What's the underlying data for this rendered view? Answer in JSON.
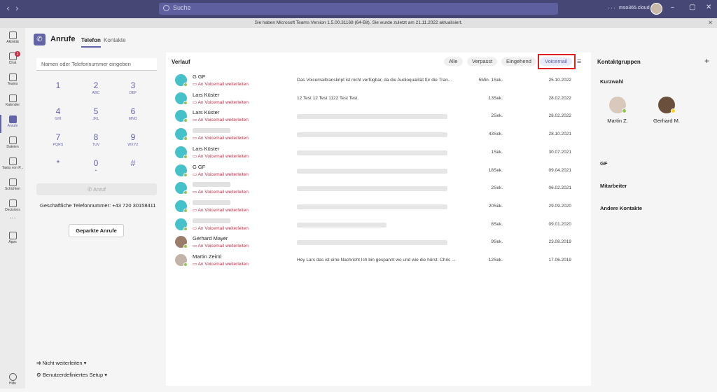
{
  "titlebar": {
    "search_placeholder": "Suche",
    "more": "···",
    "tenant": "mso365.cloud",
    "back": "‹",
    "forward": "›",
    "minimize": "–",
    "maximize": "▢",
    "close": "✕"
  },
  "banner": {
    "text": "Sie haben Microsoft Teams Version 1.5.00.31168 (64-Bit). Sie wurde zuletzt am 21.11.2022 aktualisiert.",
    "close": "✕"
  },
  "rail": [
    {
      "label": "Aktivität",
      "icon": "bell-icon"
    },
    {
      "label": "Chat",
      "icon": "chat-icon",
      "badge": "1"
    },
    {
      "label": "Teams",
      "icon": "teams-icon"
    },
    {
      "label": "Kalender",
      "icon": "calendar-icon"
    },
    {
      "label": "Anrufe",
      "icon": "phone-icon",
      "active": true
    },
    {
      "label": "Dateien",
      "icon": "file-icon"
    },
    {
      "label": "Tasks von P...",
      "icon": "tasks-icon"
    },
    {
      "label": "Schichten",
      "icon": "shifts-icon"
    },
    {
      "label": "Decisions",
      "icon": "decisions-icon"
    },
    {
      "label": "",
      "icon": "more-apps-icon"
    },
    {
      "label": "Apps",
      "icon": "apps-icon"
    },
    {
      "label": "Hilfe",
      "icon": "help-icon"
    }
  ],
  "header": {
    "title": "Anrufe",
    "tabs": [
      "Telefon",
      "Kontakte"
    ]
  },
  "dialpad": {
    "placeholder": "Namen oder Telefonnummer eingeben",
    "keys": [
      {
        "d": "1",
        "l": ""
      },
      {
        "d": "2",
        "l": "ABC"
      },
      {
        "d": "3",
        "l": "DEF"
      },
      {
        "d": "4",
        "l": "GHI"
      },
      {
        "d": "5",
        "l": "JKL"
      },
      {
        "d": "6",
        "l": "MNO"
      },
      {
        "d": "7",
        "l": "PQRS"
      },
      {
        "d": "8",
        "l": "TUV"
      },
      {
        "d": "9",
        "l": "WXYZ"
      },
      {
        "d": "*",
        "l": ""
      },
      {
        "d": "0",
        "l": "+"
      },
      {
        "d": "#",
        "l": ""
      }
    ],
    "call_label": "Anruf",
    "business_number": "Geschäftliche Telefonnummer: +43 720 30158411",
    "parked_label": "Geparkte Anrufe",
    "forward_label": "Nicht weiterleiten",
    "setup_label": "Benutzerdefiniertes Setup"
  },
  "history": {
    "title": "Verlauf",
    "filters": [
      "Alle",
      "Verpasst",
      "Eingehend",
      "Voicemail"
    ],
    "selected_filter": "Voicemail",
    "voicemail_action": "An Voicemail weiterleiten",
    "rows": [
      {
        "name": "G GF",
        "avatar": "teal",
        "transcript": "Das Voicemailtranskript ist nicht verfügbar, da die Audioqualität für die Tran...",
        "duration": "5Min. 1Sek.",
        "date": "25.10.2022"
      },
      {
        "name": "Lars Küster",
        "avatar": "teal",
        "transcript": "12 Test 12 Test 1122 Test Test.",
        "duration": "13Sek.",
        "date": "28.02.2022"
      },
      {
        "name": "Lars Küster",
        "avatar": "teal",
        "transcript": "",
        "duration": "2Sek.",
        "date": "28.02.2022"
      },
      {
        "name": "",
        "avatar": "teal",
        "transcript": "",
        "duration": "43Sek.",
        "date": "28.10.2021"
      },
      {
        "name": "Lars Küster",
        "avatar": "teal",
        "transcript": "",
        "duration": "1Sek.",
        "date": "30.07.2021"
      },
      {
        "name": "G GF",
        "avatar": "teal",
        "transcript": "",
        "duration": "18Sek.",
        "date": "09.04.2021"
      },
      {
        "name": "",
        "avatar": "teal",
        "transcript": "",
        "duration": "2Sek.",
        "date": "06.02.2021"
      },
      {
        "name": "",
        "avatar": "teal",
        "transcript": "",
        "duration": "20Sek.",
        "date": "29.09.2020"
      },
      {
        "name": "",
        "avatar": "teal",
        "transcript": "",
        "duration": "8Sek.",
        "date": "09.01.2020"
      },
      {
        "name": "Gerhard Mayer",
        "avatar": "photo",
        "transcript": "",
        "duration": "9Sek.",
        "date": "23.08.2019"
      },
      {
        "name": "Martin Zeiml",
        "avatar": "photo2",
        "transcript": "Hey Lars das ist eine Nachricht Ich bin gespannt wo und wie die hörst. Chris ...",
        "duration": "12Sek.",
        "date": "17.06.2019"
      }
    ]
  },
  "contacts": {
    "title": "Kontaktgruppen",
    "add": "+",
    "speed_dial_label": "Kurzwahl",
    "speed_dial": [
      {
        "name": "Martin Z.",
        "presence": "#92c353"
      },
      {
        "name": "Gerhard M.",
        "presence": "#fcd116"
      }
    ],
    "groups": [
      "GF",
      "Mitarbeiter",
      "Andere Kontakte"
    ]
  },
  "colors": {
    "accent": "#6264a7",
    "titlebar": "#464775",
    "voicemail_red": "#c4314b",
    "avatar_teal": "#45c1c9",
    "highlight_box": "#e02020"
  }
}
